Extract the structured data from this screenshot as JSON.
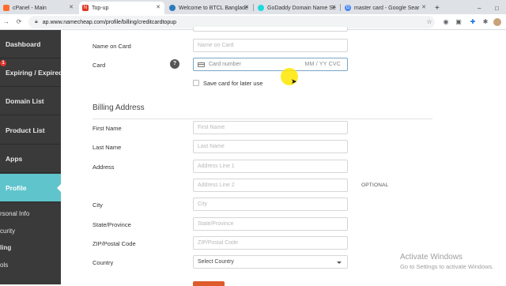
{
  "browser": {
    "tabs": [
      {
        "title": "cPanel - Main",
        "favicon_color": "#ff6c2c"
      },
      {
        "title": "Top-up",
        "favicon_color": "#de3723"
      },
      {
        "title": "Welcome to BTCL Banglade",
        "favicon_color": "#2b7bb9"
      },
      {
        "title": "GoDaddy Domain Name Se",
        "favicon_color": "#1bdbdb"
      },
      {
        "title": "master card - Google Sear",
        "favicon_color": "#4285f4"
      }
    ],
    "new_tab_label": "+",
    "url": "ap.www.namecheap.com/profile/billing/creditcardtopup",
    "window_controls": [
      "–",
      "□"
    ]
  },
  "sidebar": {
    "items": [
      {
        "label": "Dashboard"
      },
      {
        "label": "Expiring / Expired",
        "badge": "1"
      },
      {
        "label": "Domain List"
      },
      {
        "label": "Product List"
      },
      {
        "label": "Apps"
      },
      {
        "label": "Profile",
        "active": true
      }
    ],
    "subitems": [
      "rsonal Info",
      "curity",
      "ling",
      "ols"
    ]
  },
  "form": {
    "name_on_card": {
      "label": "Name on Card",
      "placeholder": "Name on Card"
    },
    "card": {
      "label": "Card",
      "placeholder": "Card number",
      "expiry_cvc": "MM / YY  CVC",
      "help": "?"
    },
    "save_card_label": "Save card for later use",
    "billing_title": "Billing Address",
    "first_name": {
      "label": "First Name",
      "placeholder": "First Name"
    },
    "last_name": {
      "label": "Last Name",
      "placeholder": "Last Name"
    },
    "address": {
      "label": "Address",
      "line1_placeholder": "Address Line 1",
      "line2_placeholder": "Address Line 2",
      "optional": "OPTIONAL"
    },
    "city": {
      "label": "City",
      "placeholder": "City"
    },
    "state": {
      "label": "State/Province",
      "placeholder": "State/Province"
    },
    "zip": {
      "label": "ZIP/Postal Code",
      "placeholder": "ZIP/Postal Code"
    },
    "country": {
      "label": "Country",
      "selected": "Select Country"
    }
  },
  "watermark": {
    "line1": "Activate Windows",
    "line2": "Go to Settings to activate Windows."
  },
  "colors": {
    "sidebar_bg": "#3a3a3a",
    "active_nav": "#5fc4cc",
    "badge": "#e0342a",
    "submit": "#de5b2b"
  }
}
